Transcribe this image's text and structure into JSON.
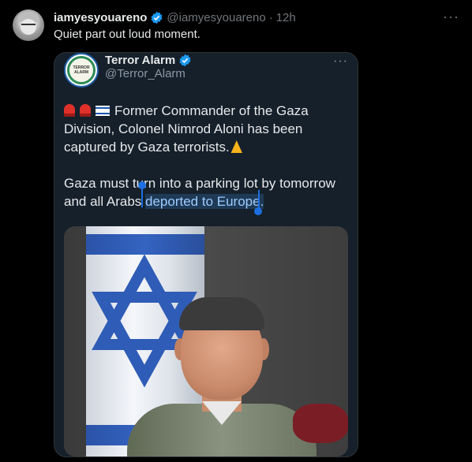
{
  "tweet": {
    "display_name": "iamyesyouareno",
    "handle": "@iamyesyouareno",
    "separator": "·",
    "time": "12h",
    "more": "···",
    "text": "Quiet part out loud moment."
  },
  "quote": {
    "display_name": "Terror Alarm",
    "handle": "@Terror_Alarm",
    "more": "···",
    "avatar_label": "TERROR ALARM",
    "line1": "Former Commander of the Gaza Division, Colonel Nimrod Aloni has been captured by Gaza terrorists.",
    "line2_plain": "Gaza must turn into a parking lot by tomorrow and all Arabs ",
    "line2_selected": "deported to Europe."
  },
  "colors": {
    "background": "#000000",
    "verified": "#1d9bf0",
    "muted": "#71767b",
    "selection": "#1d6fe0"
  },
  "icons": [
    "verified-badge-icon",
    "more-icon",
    "siren-emoji",
    "israel-flag-emoji",
    "praying-hands-emoji"
  ]
}
